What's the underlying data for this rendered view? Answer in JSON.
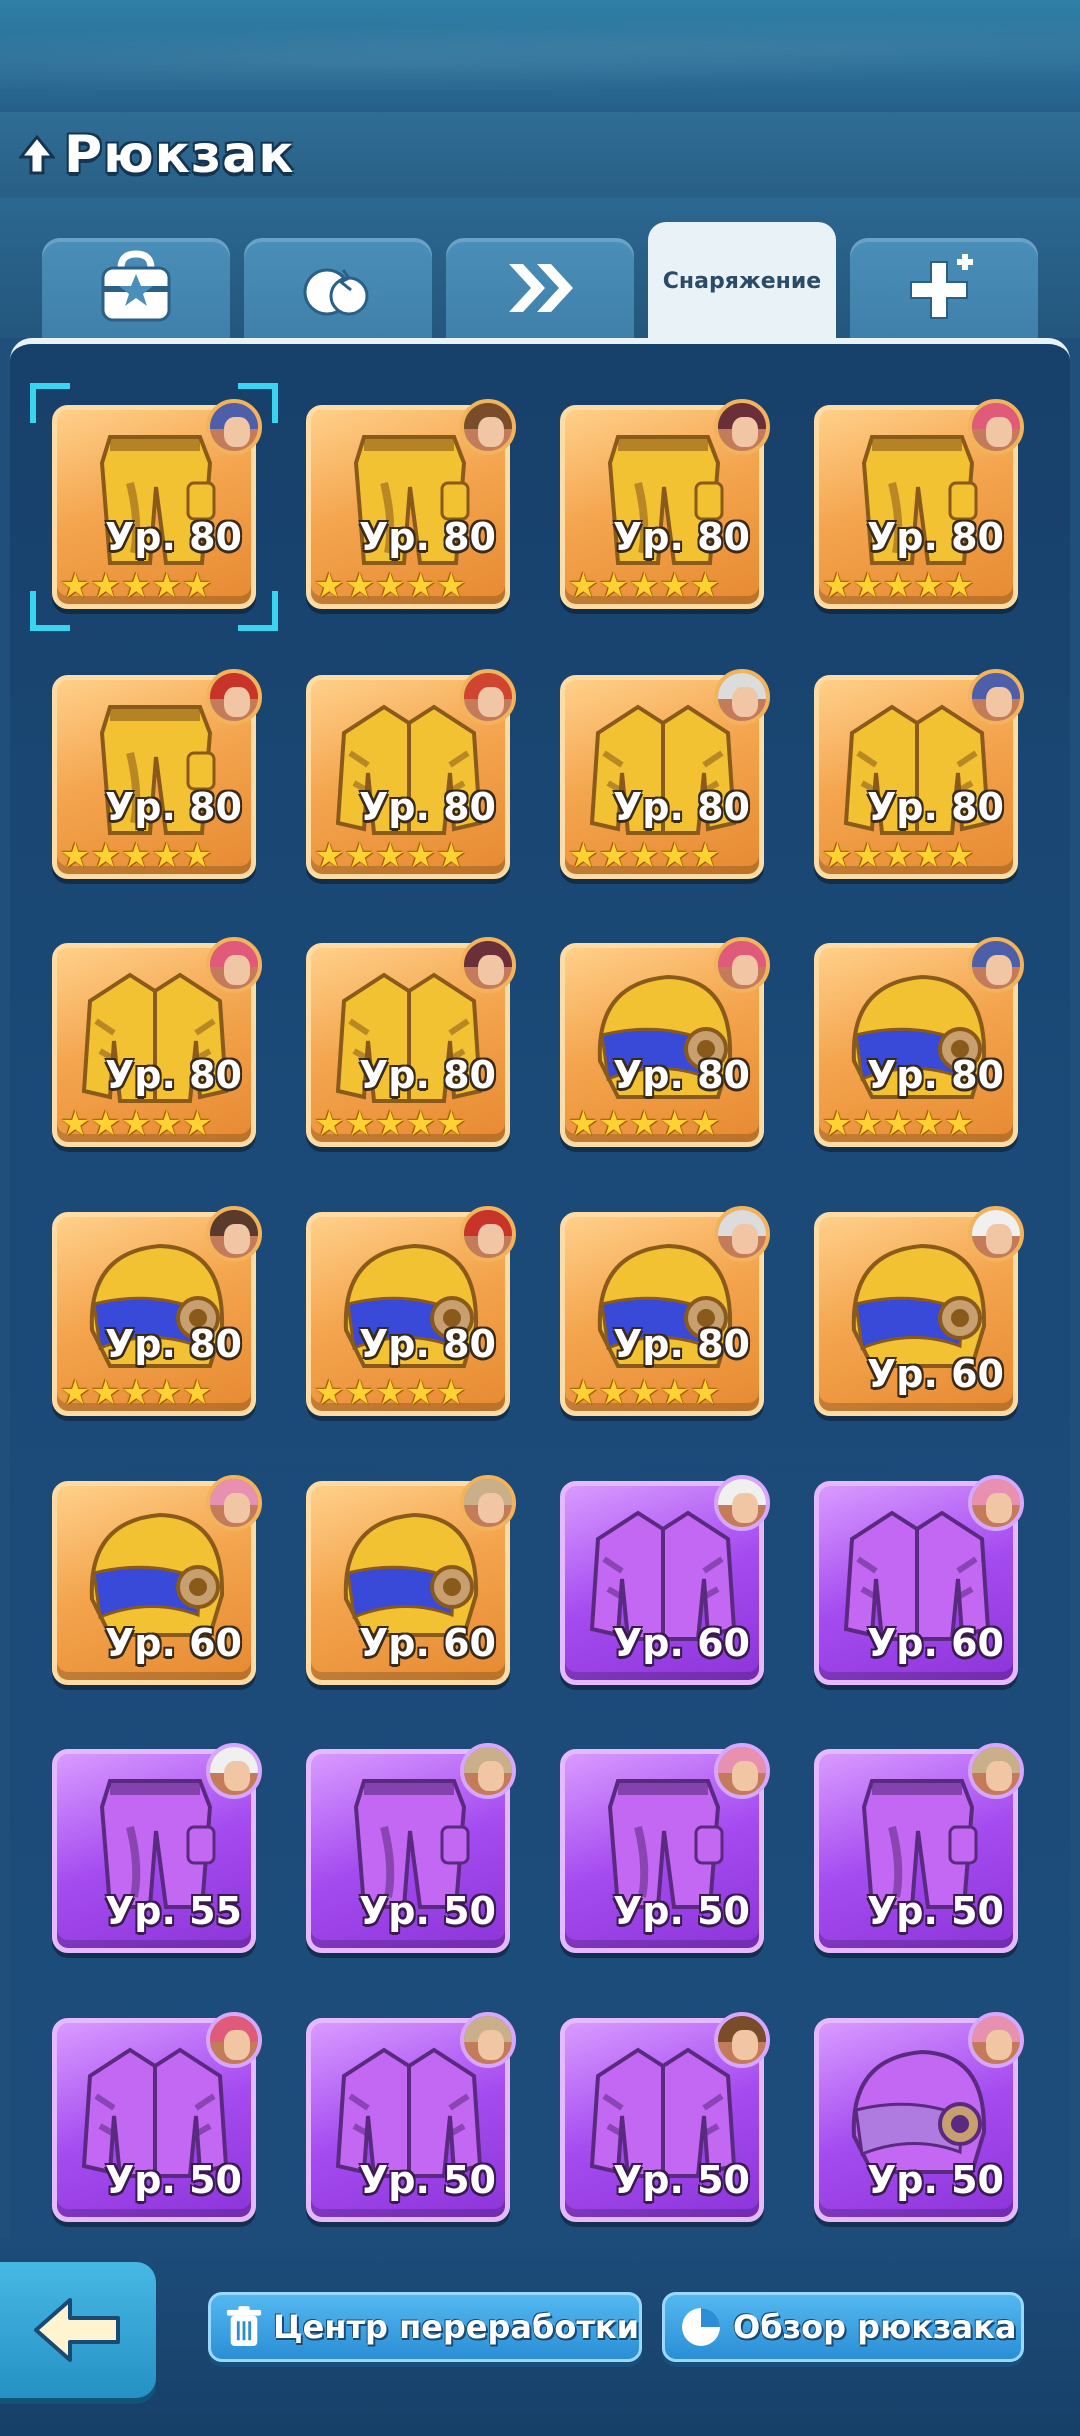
{
  "header": {
    "title": "Рюкзак",
    "back_icon": "tree-up-icon"
  },
  "tabs": [
    {
      "icon": "bag-star-icon",
      "label": ""
    },
    {
      "icon": "potions-icon",
      "label": ""
    },
    {
      "icon": "double-chevron-icon",
      "label": ""
    },
    {
      "icon": "",
      "label": "Снаряжение",
      "active": true
    },
    {
      "icon": "cross-plus-icon",
      "label": ""
    }
  ],
  "colors": {
    "gold_card": "#f4a54e",
    "purple_card": "#a54cf0",
    "accent_cyan": "#38d4f0",
    "panel": "#1b4a78"
  },
  "items": [
    {
      "type": "pants",
      "rarity": "gold",
      "level": "Ур. 80",
      "stars": 5,
      "avatar_hair": "#4d5fa8"
    },
    {
      "type": "pants",
      "rarity": "gold",
      "level": "Ур. 80",
      "stars": 5,
      "avatar_hair": "#7a4d2a"
    },
    {
      "type": "pants",
      "rarity": "gold",
      "level": "Ур. 80",
      "stars": 5,
      "avatar_hair": "#6b2f3a"
    },
    {
      "type": "pants",
      "rarity": "gold",
      "level": "Ур. 80",
      "stars": 5,
      "avatar_hair": "#e05a7a"
    },
    {
      "type": "pants",
      "rarity": "gold",
      "level": "Ур. 80",
      "stars": 5,
      "avatar_hair": "#c8332a"
    },
    {
      "type": "jacket",
      "rarity": "gold",
      "level": "Ур. 80",
      "stars": 5,
      "avatar_hair": "#d0452f"
    },
    {
      "type": "jacket",
      "rarity": "gold",
      "level": "Ур. 80",
      "stars": 5,
      "avatar_hair": "#dcdcdc"
    },
    {
      "type": "jacket",
      "rarity": "gold",
      "level": "Ур. 80",
      "stars": 5,
      "avatar_hair": "#4d5fa8"
    },
    {
      "type": "jacket",
      "rarity": "gold",
      "level": "Ур. 80",
      "stars": 5,
      "avatar_hair": "#e05a7a"
    },
    {
      "type": "jacket",
      "rarity": "gold",
      "level": "Ур. 80",
      "stars": 5,
      "avatar_hair": "#6b2f3a"
    },
    {
      "type": "helmet",
      "rarity": "gold",
      "level": "Ур. 80",
      "stars": 5,
      "avatar_hair": "#e05a7a"
    },
    {
      "type": "helmet",
      "rarity": "gold",
      "level": "Ур. 80",
      "stars": 5,
      "avatar_hair": "#4d5fa8"
    },
    {
      "type": "helmet",
      "rarity": "gold",
      "level": "Ур. 80",
      "stars": 5,
      "avatar_hair": "#5a3a2a"
    },
    {
      "type": "helmet",
      "rarity": "gold",
      "level": "Ур. 80",
      "stars": 5,
      "avatar_hair": "#c8332a"
    },
    {
      "type": "helmet",
      "rarity": "gold",
      "level": "Ур. 80",
      "stars": 5,
      "avatar_hair": "#dcdcdc"
    },
    {
      "type": "helmet",
      "rarity": "gold",
      "level": "Ур. 60",
      "stars": 0,
      "avatar_hair": "#f0f0f0"
    },
    {
      "type": "helmet",
      "rarity": "gold",
      "level": "Ур. 60",
      "stars": 0,
      "avatar_hair": "#e890b0"
    },
    {
      "type": "helmet",
      "rarity": "gold",
      "level": "Ур. 60",
      "stars": 0,
      "avatar_hair": "#c9b08a"
    },
    {
      "type": "jacket",
      "rarity": "purple",
      "level": "Ур. 60",
      "stars": 0,
      "avatar_hair": "#f0f0f0"
    },
    {
      "type": "jacket",
      "rarity": "purple",
      "level": "Ур. 60",
      "stars": 0,
      "avatar_hair": "#e890b0"
    },
    {
      "type": "pants",
      "rarity": "purple",
      "level": "Ур. 55",
      "stars": 0,
      "avatar_hair": "#f0f0f0"
    },
    {
      "type": "pants",
      "rarity": "purple",
      "level": "Ур. 50",
      "stars": 0,
      "avatar_hair": "#c9b08a"
    },
    {
      "type": "pants",
      "rarity": "purple",
      "level": "Ур. 50",
      "stars": 0,
      "avatar_hair": "#e890b0"
    },
    {
      "type": "pants",
      "rarity": "purple",
      "level": "Ур. 50",
      "stars": 0,
      "avatar_hair": "#c9b08a"
    },
    {
      "type": "jacket",
      "rarity": "purple",
      "level": "Ур. 50",
      "stars": 0,
      "avatar_hair": "#e05a7a"
    },
    {
      "type": "jacket",
      "rarity": "purple",
      "level": "Ур. 50",
      "stars": 0,
      "avatar_hair": "#c9b08a"
    },
    {
      "type": "jacket",
      "rarity": "purple",
      "level": "Ур. 50",
      "stars": 0,
      "avatar_hair": "#7a4d2a"
    },
    {
      "type": "helmet",
      "rarity": "purple",
      "level": "Ур. 50",
      "stars": 0,
      "avatar_hair": "#e890b0"
    }
  ],
  "selected_index": 0,
  "bottom": {
    "back_icon": "back-arrow-icon",
    "recycle_label": "Центр переработки",
    "recycle_icon": "trash-icon",
    "overview_label": "Обзор рюкзака",
    "overview_icon": "pie-chart-icon"
  }
}
